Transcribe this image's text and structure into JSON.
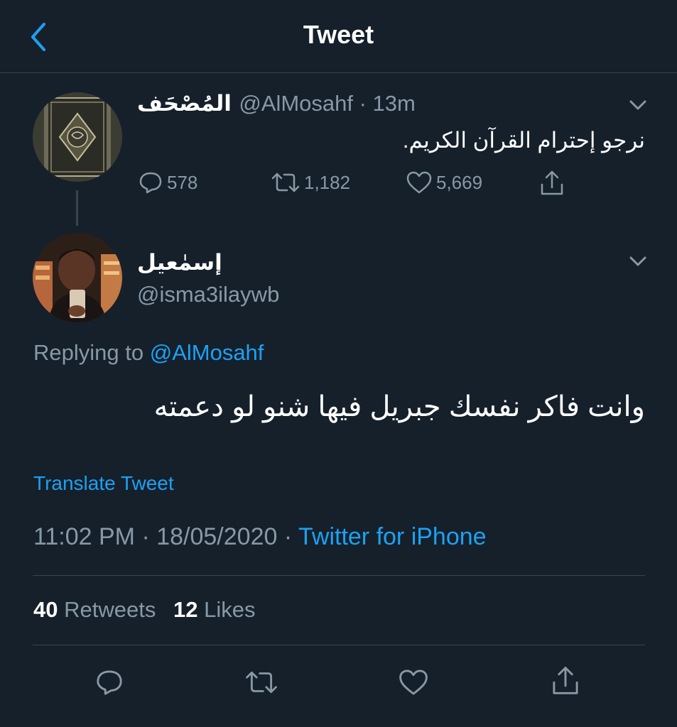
{
  "header": {
    "title": "Tweet",
    "back_icon": "chevron-left-icon"
  },
  "quoted_tweet": {
    "display_name": "المُصْحَف",
    "handle_line": "@AlMosahf · 13m",
    "text": "نرجو إحترام القرآن الكريم.",
    "reply_count": "578",
    "retweet_count": "1,182",
    "like_count": "5,669"
  },
  "main_tweet": {
    "display_name": "إسمٰعيل",
    "handle": "@isma3ilaywb",
    "replying_prefix": "Replying to ",
    "replying_to": "@AlMosahf",
    "text": "وانت فاكر نفسك جبريل فيها شنو لو دعمته",
    "translate_label": "Translate Tweet",
    "timestamp": "11:02 PM · 18/05/2020 · ",
    "source": "Twitter for iPhone",
    "retweets_count": "40",
    "retweets_label": "Retweets",
    "likes_count": "12",
    "likes_label": "Likes"
  },
  "colors": {
    "background": "#15202b",
    "accent": "#1da1f2",
    "muted": "#8899a6",
    "divider": "#38444d"
  }
}
